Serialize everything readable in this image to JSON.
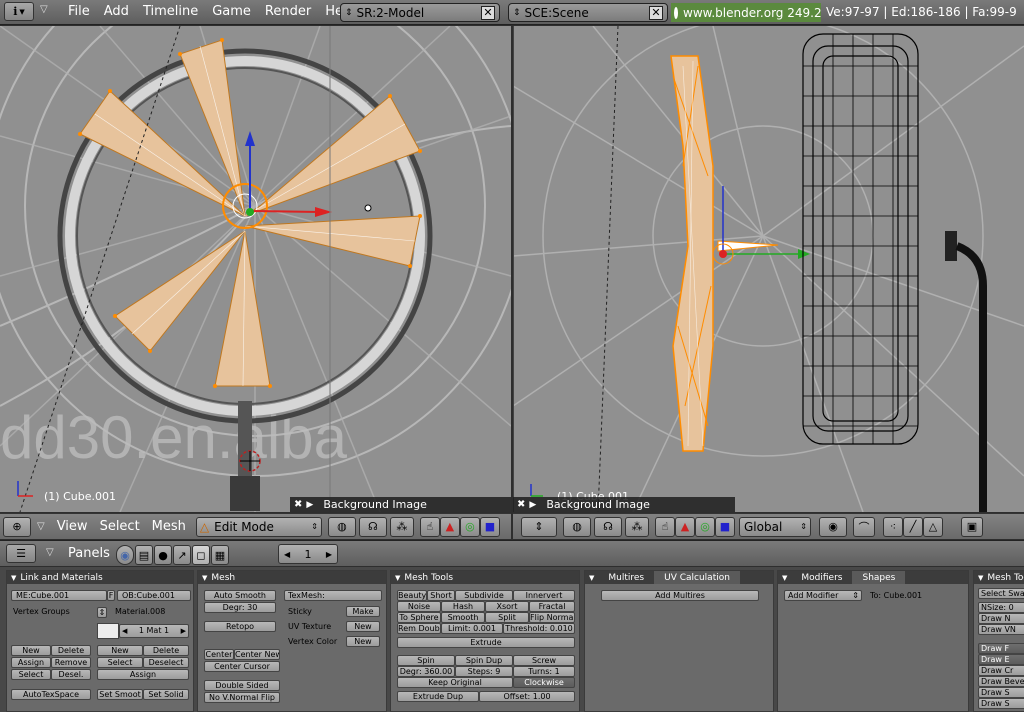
{
  "topbar": {
    "info_icon": "i",
    "menus": [
      "File",
      "Add",
      "Timeline",
      "Game",
      "Render",
      "Help"
    ],
    "screen_field": "SR:2-Model",
    "scene_field": "SCE:Scene",
    "url": "www.blender.org 249.2",
    "stats": "Ve:97-97 | Ed:186-186 | Fa:99-9"
  },
  "left_viewport": {
    "object_label": "(1) Cube.001",
    "bg_label": "Background Image",
    "watermark": "dd30.en.alba",
    "header": {
      "menus": [
        "View",
        "Select",
        "Mesh"
      ],
      "mode": "Edit Mode"
    }
  },
  "right_viewport": {
    "object_label": "(1) Cube.001",
    "bg_label": "Background Image",
    "header": {
      "orientation": "Global"
    }
  },
  "panels_bar": {
    "label": "Panels",
    "page": "1"
  },
  "link_materials": {
    "title": "Link and Materials",
    "me": "ME:Cube.001",
    "f": "F",
    "ob": "OB:Cube.001",
    "vertex_groups": "Vertex Groups",
    "material": "Material.008",
    "mat": "1 Mat 1",
    "buttons": [
      "New",
      "Delete",
      "Assign",
      "Remove",
      "Select",
      "Desel."
    ],
    "mat_buttons": [
      "New",
      "Delete",
      "Select",
      "Deselect",
      "Assign"
    ],
    "autotex": "AutoTexSpace",
    "set_smooth": "Set Smoot",
    "set_solid": "Set Solid"
  },
  "mesh": {
    "title": "Mesh",
    "auto_smooth": "Auto Smooth",
    "degr": "Degr: 30",
    "retopo": "Retopo",
    "center": "Center",
    "center_new": "Center New",
    "center_cursor": "Center Cursor",
    "double_sided": "Double Sided",
    "no_vnormal": "No V.Normal Flip",
    "texmesh": "TexMesh:",
    "sticky": "Sticky",
    "make": "Make",
    "uv_texture": "UV Texture",
    "new1": "New",
    "vertex_color": "Vertex Color",
    "new2": "New"
  },
  "mesh_tools": {
    "title": "Mesh Tools",
    "beauty": "Beauty",
    "short": "Short",
    "subdivide": "Subdivide",
    "innervert": "Innervert",
    "noise": "Noise",
    "hash": "Hash",
    "xsort": "Xsort",
    "fractal": "Fractal",
    "to_sphere": "To Sphere",
    "smooth": "Smooth",
    "split": "Split",
    "flip_normal": "Flip Normal",
    "rem_doubl": "Rem Doubl",
    "limit": "Limit: 0.001",
    "threshold": "Threshold: 0.010",
    "extrude": "Extrude",
    "spin": "Spin",
    "spin_dup": "Spin Dup",
    "screw": "Screw",
    "degr": "Degr: 360.00",
    "steps": "Steps: 9",
    "turns": "Turns: 1",
    "keep_original": "Keep Original",
    "clockwise": "Clockwise",
    "extrude_dup": "Extrude Dup",
    "offset": "Offset: 1.00"
  },
  "multires": {
    "tab1": "Multires",
    "tab2": "UV Calculation",
    "add": "Add Multires"
  },
  "modifiers": {
    "tab1": "Modifiers",
    "tab2": "Shapes",
    "add": "Add Modifier",
    "to": "To: Cube.001"
  },
  "mesh_tools_more": {
    "title": "Mesh Too",
    "items": [
      "Select Swa",
      "NSize: 0",
      "Draw N",
      "Draw VN",
      "Draw F",
      "Draw E",
      "Draw Cr",
      "Draw Beve",
      "Draw S",
      "Draw S"
    ]
  }
}
